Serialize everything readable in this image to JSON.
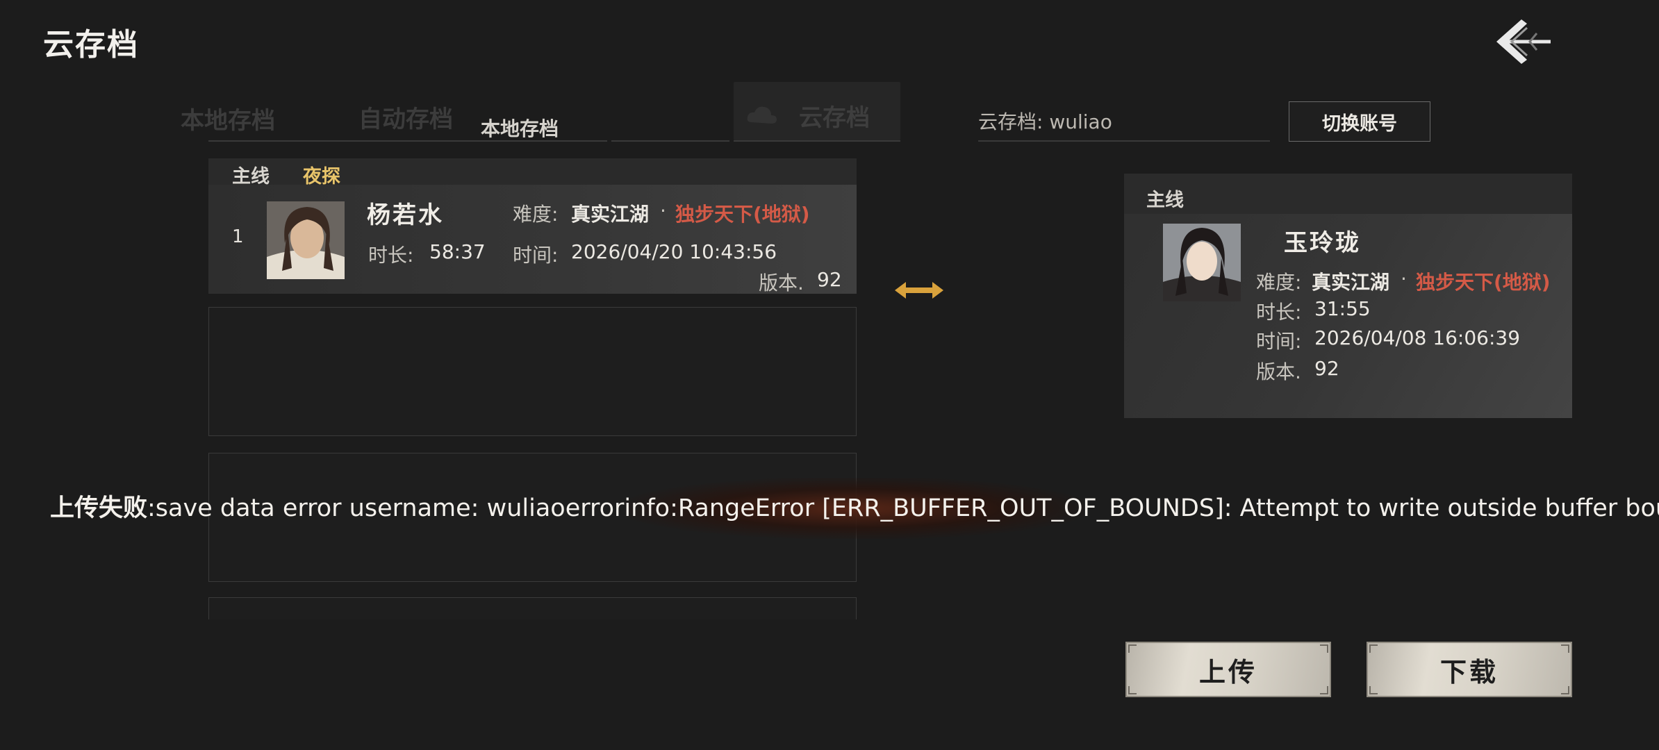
{
  "header": {
    "title": "云存档",
    "back_icon": "back-arrow-icon"
  },
  "tabs": [
    {
      "label": "本地存档"
    },
    {
      "label": "自动存档"
    },
    {
      "label": "云存档",
      "icon": "cloud-icon"
    }
  ],
  "local_panel": {
    "title": "本地存档",
    "modes": [
      "主线",
      "夜探"
    ],
    "save": {
      "index": "1",
      "name": "杨若水",
      "difficulty_label": "难度:",
      "difficulty_value": "真实江湖",
      "difficulty_sep": "·",
      "difficulty_extra": "独步天下(地狱)",
      "duration_label": "时长:",
      "duration_value": "58:37",
      "time_label": "时间:",
      "time_value": "2026/04/20 10:43:56",
      "version_label": "版本.",
      "version_value": "92"
    }
  },
  "cloud_panel": {
    "account_label": "云存档: wuliao",
    "switch_label": "切换账号",
    "mode": "主线",
    "save": {
      "name": "玉玲珑",
      "difficulty_label": "难度:",
      "difficulty_value": "真实江湖",
      "difficulty_sep": "·",
      "difficulty_extra": "独步天下(地狱)",
      "duration_label": "时长:",
      "duration_value": "31:55",
      "time_label": "时间:",
      "time_value": "2026/04/08 16:06:39",
      "version_label": "版本.",
      "version_value": "92"
    }
  },
  "swap_icon": "swap-arrows-icon",
  "toast": {
    "prefix": "上传失败",
    "message": ":save data error username: wuliaoerrorinfo:RangeError [ERR_BUFFER_OUT_OF_BOUNDS]: Attempt to write outside buffer bounds"
  },
  "actions": {
    "upload": "上传",
    "download": "下载"
  },
  "colors": {
    "accent_red": "#d45a47",
    "accent_gold": "#e8c46a",
    "swap_gold": "#d9a23c"
  }
}
